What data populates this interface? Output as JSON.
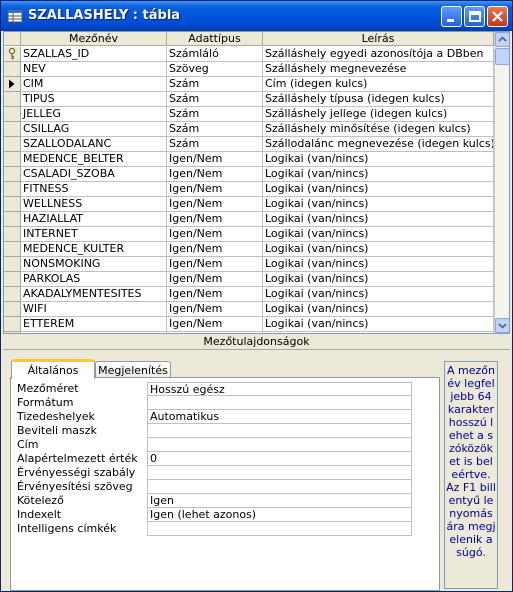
{
  "window": {
    "title": "SZALLASHELY : tábla"
  },
  "grid": {
    "headers": [
      "Mezőnév",
      "Adattípus",
      "Leírás"
    ],
    "rows": [
      {
        "name": "SZALLAS_ID",
        "type": "Számláló",
        "desc": "Szálláshely egyedi azonosítója a DBben",
        "key": true
      },
      {
        "name": "NEV",
        "type": "Szöveg",
        "desc": "Szálláshely megnevezése"
      },
      {
        "name": "CIM",
        "type": "Szám",
        "desc": "Cím (idegen kulcs)",
        "current": true
      },
      {
        "name": "TIPUS",
        "type": "Szám",
        "desc": "Szálláshely típusa (idegen kulcs)"
      },
      {
        "name": "JELLEG",
        "type": "Szám",
        "desc": "Szálláshely jellege (idegen kulcs)"
      },
      {
        "name": "CSILLAG",
        "type": "Szám",
        "desc": "Szálláshely minősítése (idegen kulcs)"
      },
      {
        "name": "SZALLODALANC",
        "type": "Szám",
        "desc": "Szállodalánc megnevezése (idegen kulcs)"
      },
      {
        "name": "MEDENCE_BELTER",
        "type": "Igen/Nem",
        "desc": "Logikai (van/nincs)"
      },
      {
        "name": "CSALADI_SZOBA",
        "type": "Igen/Nem",
        "desc": "Logikai (van/nincs)"
      },
      {
        "name": "FITNESS",
        "type": "Igen/Nem",
        "desc": "Logikai (van/nincs)"
      },
      {
        "name": "WELLNESS",
        "type": "Igen/Nem",
        "desc": "Logikai (van/nincs)"
      },
      {
        "name": "HAZIALLAT",
        "type": "Igen/Nem",
        "desc": "Logikai (van/nincs)"
      },
      {
        "name": "INTERNET",
        "type": "Igen/Nem",
        "desc": "Logikai (van/nincs)"
      },
      {
        "name": "MEDENCE_KULTER",
        "type": "Igen/Nem",
        "desc": "Logikai (van/nincs)"
      },
      {
        "name": "NONSMOKING",
        "type": "Igen/Nem",
        "desc": "Logikai (van/nincs)"
      },
      {
        "name": "PARKOLAS",
        "type": "Igen/Nem",
        "desc": "Logikai (van/nincs)"
      },
      {
        "name": "AKADALYMENTESITES",
        "type": "Igen/Nem",
        "desc": "Logikai (van/nincs)"
      },
      {
        "name": "WIFI",
        "type": "Igen/Nem",
        "desc": "Logikai (van/nincs)"
      },
      {
        "name": "ETTEREM",
        "type": "Igen/Nem",
        "desc": "Logikai (van/nincs)"
      },
      {
        "name": "",
        "type": "",
        "desc": ""
      },
      {
        "name": "",
        "type": "",
        "desc": ""
      }
    ]
  },
  "properties": {
    "section_title": "Mezőtulajdonságok",
    "tabs": [
      "Általános",
      "Megjelenítés"
    ],
    "active_tab": "Általános",
    "fields": [
      {
        "label": "Mezőméret",
        "value": "Hosszú egész"
      },
      {
        "label": "Formátum",
        "value": ""
      },
      {
        "label": "Tizedeshelyek",
        "value": "Automatikus"
      },
      {
        "label": "Beviteli maszk",
        "value": ""
      },
      {
        "label": "Cím",
        "value": ""
      },
      {
        "label": "Alapértelmezett érték",
        "value": "0"
      },
      {
        "label": "Érvényességi szabály",
        "value": ""
      },
      {
        "label": "Érvényesítési szöveg",
        "value": ""
      },
      {
        "label": "Kötelező",
        "value": "Igen"
      },
      {
        "label": "Indexelt",
        "value": "Igen (lehet azonos)"
      },
      {
        "label": "Intelligens címkék",
        "value": ""
      }
    ],
    "help_text": "A mezőnév legfeljebb 64 karakter hosszú lehet a szóközöket is beleértve. Az F1 billentyű lenyomására megjelenik a súgó."
  },
  "colors": {
    "title_bar": "#0054e3",
    "help_text": "#0000a0",
    "active_tab_accent": "#ffc83c"
  }
}
